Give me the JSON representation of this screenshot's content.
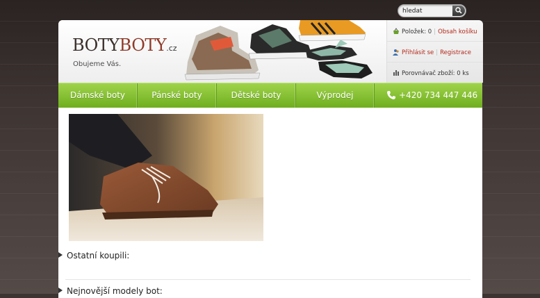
{
  "search": {
    "placeholder": "hledat",
    "value": "hledat"
  },
  "logo": {
    "part1": "BOTY",
    "part2": "BOTY",
    "tld": ".cz",
    "tagline": "Obujeme Vás."
  },
  "user_panel": {
    "items_label": "Položek: 0",
    "cart_link": "Obsah košíku",
    "login_link": "Přihlásit se",
    "register_link": "Registrace",
    "compare_label": "Porovnávač zboží: 0 ks"
  },
  "nav": {
    "items": [
      {
        "label": "Dámské boty"
      },
      {
        "label": "Pánské boty"
      },
      {
        "label": "Dětské boty"
      },
      {
        "label": "Výprodej"
      }
    ],
    "phone": "+420 734 447 446"
  },
  "sections": {
    "others_bought": "Ostatní koupili:",
    "newest_models": "Nejnovější modely bot:"
  },
  "colors": {
    "nav_green": "#7cbc26",
    "link_red": "#b2281a",
    "logo_red": "#8f3a2a"
  }
}
